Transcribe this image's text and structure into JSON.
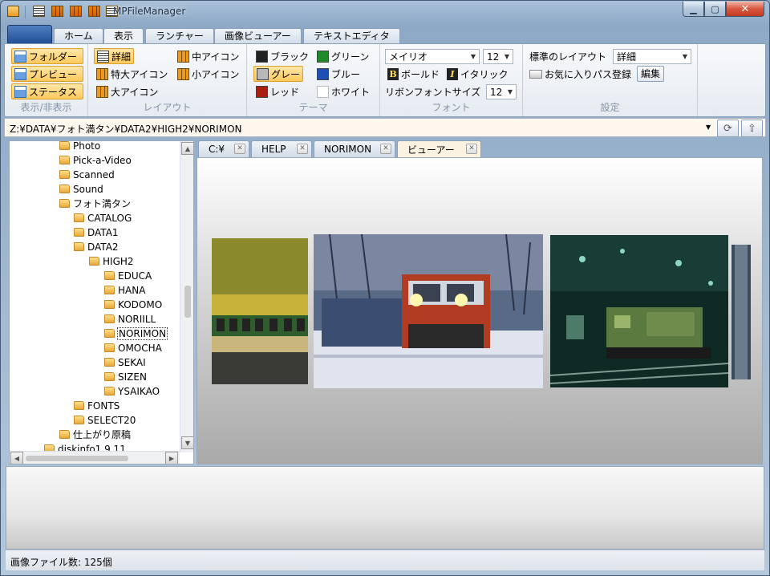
{
  "window": {
    "title": "MPFileManager"
  },
  "ribbon_tabs": [
    {
      "label": ""
    },
    {
      "label": "ホーム"
    },
    {
      "label": "表示"
    },
    {
      "label": "ランチャー"
    },
    {
      "label": "画像ビューアー"
    },
    {
      "label": "テキストエディタ"
    }
  ],
  "groups": {
    "show": {
      "label": "表示/非表示",
      "folder": "フォルダー",
      "preview": "プレビュー",
      "status": "ステータス"
    },
    "layout": {
      "label": "レイアウト",
      "detail": "詳細",
      "xlarge": "特大アイコン",
      "large": "大アイコン",
      "medium": "中アイコン",
      "small": "小アイコン"
    },
    "theme": {
      "label": "テーマ",
      "black": "ブラック",
      "gray": "グレー",
      "red": "レッド",
      "green": "グリーン",
      "blue": "ブルー",
      "white": "ホワイト",
      "colors": {
        "black": "#222222",
        "gray": "#b8b8b8",
        "red": "#a81e0f",
        "green": "#1e8a2a",
        "blue": "#1f4fb3",
        "white": "#ffffff"
      }
    },
    "font": {
      "label": "フォント",
      "family": "メイリオ",
      "size": "12",
      "bold": "ボールド",
      "italic": "イタリック",
      "ribbon_font_size_label": "リボンフォントサイズ",
      "ribbon_font_size": "12"
    },
    "settings": {
      "label": "設定",
      "default_layout_label": "標準のレイアウト",
      "default_layout": "詳細",
      "favorites": "お気に入りパス登録",
      "edit": "編集"
    }
  },
  "address": {
    "path": "Z:¥DATA¥フォト満タン¥DATA2¥HIGH2¥NORIMON"
  },
  "tree": [
    {
      "label": "Photo",
      "level": 0
    },
    {
      "label": "Pick-a-Video",
      "level": 0
    },
    {
      "label": "Scanned",
      "level": 0
    },
    {
      "label": "Sound",
      "level": 0
    },
    {
      "label": "フォト満タン",
      "level": 0
    },
    {
      "label": "CATALOG",
      "level": 1
    },
    {
      "label": "DATA1",
      "level": 1
    },
    {
      "label": "DATA2",
      "level": 1
    },
    {
      "label": "HIGH2",
      "level": 2
    },
    {
      "label": "EDUCA",
      "level": 3
    },
    {
      "label": "HANA",
      "level": 3
    },
    {
      "label": "KODOMO",
      "level": 3
    },
    {
      "label": "NORIILL",
      "level": 3
    },
    {
      "label": "NORIMON",
      "level": 3,
      "selected": true
    },
    {
      "label": "OMOCHA",
      "level": 3
    },
    {
      "label": "SEKAI",
      "level": 3
    },
    {
      "label": "SIZEN",
      "level": 3
    },
    {
      "label": "YSAIKAO",
      "level": 3
    },
    {
      "label": "FONTS",
      "level": 1
    },
    {
      "label": "SELECT20",
      "level": 1
    },
    {
      "label": "仕上がり原稿",
      "level": 0
    },
    {
      "label": "diskinfo1.9.11",
      "level": -1
    }
  ],
  "tabs": [
    {
      "label": "C:¥"
    },
    {
      "label": "HELP"
    },
    {
      "label": "NORIMON"
    },
    {
      "label": "ビューアー"
    }
  ],
  "status": {
    "text": "画像ファイル数: 125個"
  }
}
